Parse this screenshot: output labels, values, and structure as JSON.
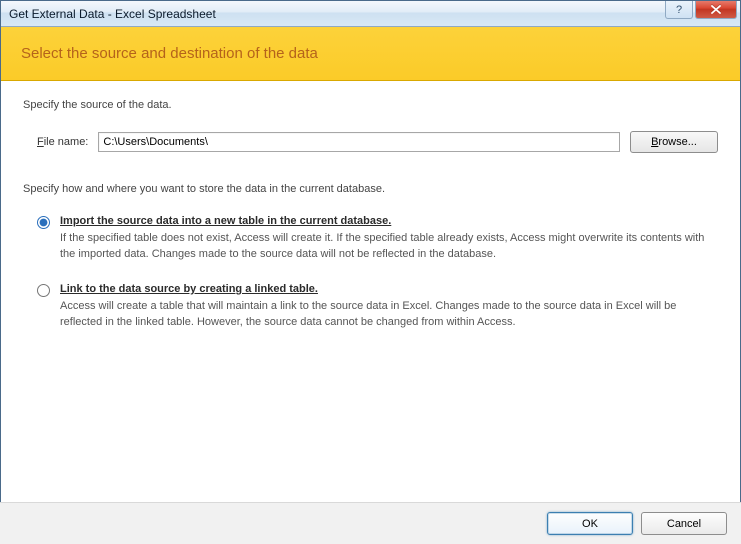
{
  "window": {
    "title": "Get External Data - Excel Spreadsheet",
    "help_symbol": "?",
    "close_symbol": "✕"
  },
  "banner": {
    "heading": "Select the source and destination of the data"
  },
  "source": {
    "instruction": "Specify the source of the data.",
    "file_label_accesskey": "F",
    "file_label_rest": "ile name:",
    "file_value": "C:\\Users\\Documents\\",
    "browse_accesskey": "B",
    "browse_rest": "rowse..."
  },
  "storage": {
    "instruction": "Specify how and where you want to store the data in the current database.",
    "selected": "import",
    "options": {
      "import": {
        "title": "Import the source data into a new table in the current database.",
        "desc": "If the specified table does not exist, Access will create it. If the specified table already exists, Access might overwrite its contents with the imported data. Changes made to the source data will not be reflected in the database."
      },
      "link": {
        "title": "Link to the data source by creating a linked table.",
        "desc": "Access will create a table that will maintain a link to the source data in Excel. Changes made to the source data in Excel will be reflected in the linked table. However, the source data cannot be changed from within Access."
      }
    }
  },
  "buttons": {
    "ok": "OK",
    "cancel": "Cancel"
  }
}
